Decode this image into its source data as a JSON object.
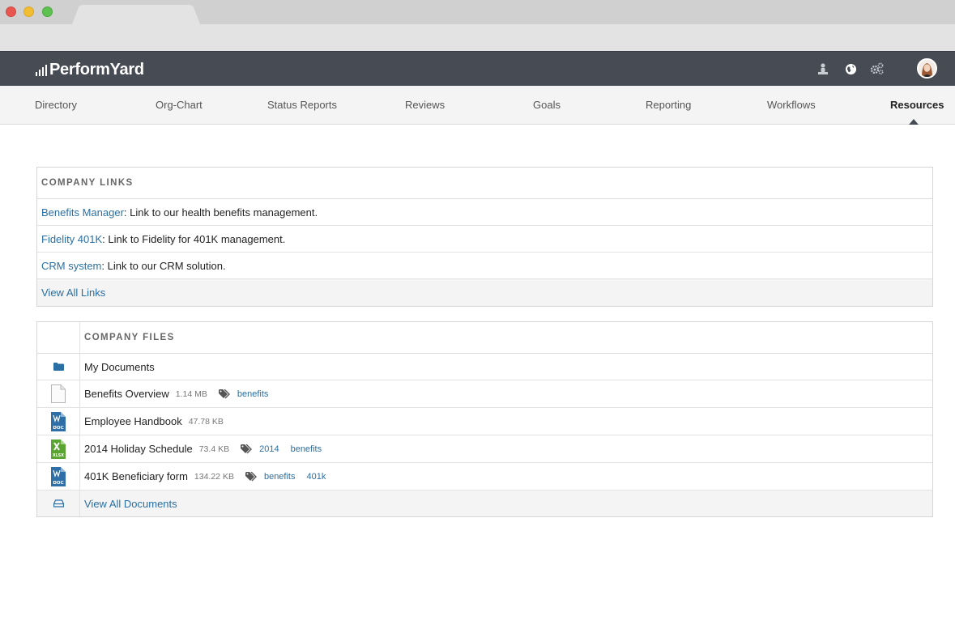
{
  "app": {
    "name": "PerformYard",
    "brand_color": "#474b54",
    "link_color": "#2a6fa3"
  },
  "header_icons": [
    {
      "name": "org-person-icon"
    },
    {
      "name": "globe-icon"
    },
    {
      "name": "settings-gears-icon"
    }
  ],
  "nav": {
    "items": [
      {
        "label": "Directory"
      },
      {
        "label": "Org-Chart"
      },
      {
        "label": "Status Reports"
      },
      {
        "label": "Reviews"
      },
      {
        "label": "Goals"
      },
      {
        "label": "Reporting"
      },
      {
        "label": "Workflows"
      },
      {
        "label": "Resources",
        "active": true
      }
    ]
  },
  "company_links": {
    "heading": "COMPANY LINKS",
    "items": [
      {
        "link": "Benefits Manager",
        "desc": ": Link to our health benefits management."
      },
      {
        "link": "Fidelity 401K",
        "desc": ": Link to Fidelity for 401K management."
      },
      {
        "link": "CRM system",
        "desc": ": Link to our CRM solution."
      }
    ],
    "view_all": "View All Links"
  },
  "company_files": {
    "heading": "COMPANY FILES",
    "folder": {
      "name": "My Documents",
      "icon": "folder-icon"
    },
    "files": [
      {
        "name": "Benefits Overview",
        "size": "1.14 MB",
        "icon": "blank-file-icon",
        "tags": [
          "benefits"
        ]
      },
      {
        "name": "Employee Handbook",
        "size": "47.78 KB",
        "icon": "doc-file-icon",
        "tags": []
      },
      {
        "name": "2014 Holiday Schedule",
        "size": "73.4 KB",
        "icon": "xlsx-file-icon",
        "tags": [
          "2014",
          "benefits"
        ]
      },
      {
        "name": "401K Beneficiary form",
        "size": "134.22 KB",
        "icon": "doc-file-icon",
        "tags": [
          "benefits",
          "401k"
        ]
      }
    ],
    "view_all": "View All Documents",
    "doc_label": "DOC",
    "xlsx_label": "XLSX"
  }
}
